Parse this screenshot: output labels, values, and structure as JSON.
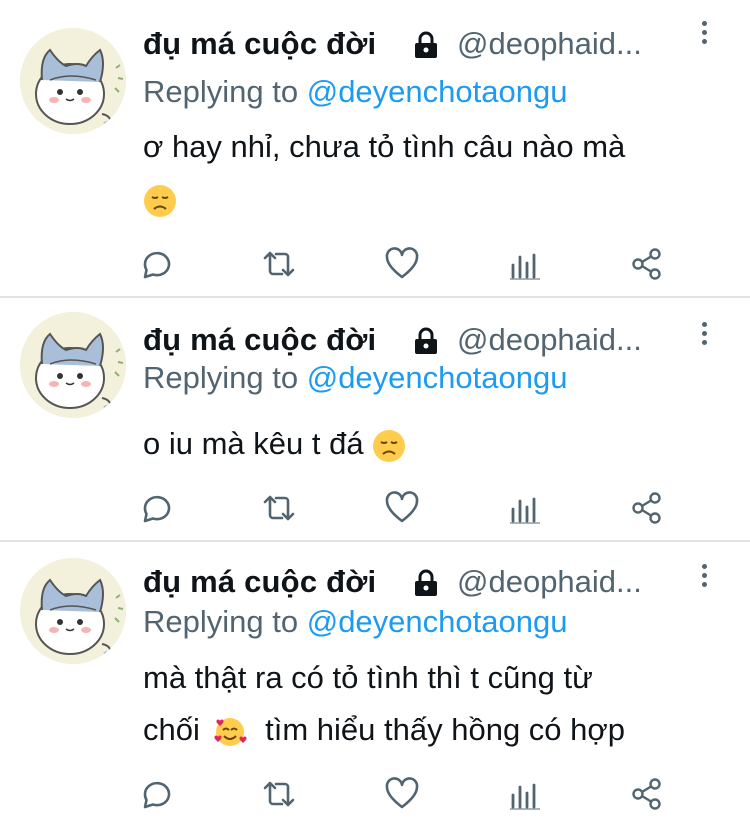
{
  "tweets": [
    {
      "name": "đụ má cuộc đời",
      "handle": "@deophaid...",
      "reply_prefix": "Replying to",
      "reply_to": "@deyenchotaongu",
      "line1": "ơ hay nhỉ, chưa tỏ tình câu nào mà",
      "line2": "",
      "emoji": "disappointed-face"
    },
    {
      "name": "đụ má cuộc đời",
      "handle": "@deophaid...",
      "reply_prefix": "Replying to",
      "reply_to": "@deyenchotaongu",
      "line1": "o iu mà kêu t đá",
      "emoji": "disappointed-face"
    },
    {
      "name": "đụ má cuộc đời",
      "handle": "@deophaid...",
      "reply_prefix": "Replying to",
      "reply_to": "@deyenchotaongu",
      "line1": "mà thật ra có tỏ tình thì t cũng từ",
      "line2_a": "chối",
      "line2_b": "tìm hiểu thấy hồng có hợp",
      "emoji": "smiling-face-with-hearts"
    }
  ],
  "actions": [
    "reply-icon",
    "retweet-icon",
    "like-icon",
    "analytics-icon",
    "share-icon"
  ],
  "colors": {
    "text": "#0f1419",
    "secondary": "#536471",
    "link": "#1d9bf0",
    "divider": "#dfe3e7"
  }
}
